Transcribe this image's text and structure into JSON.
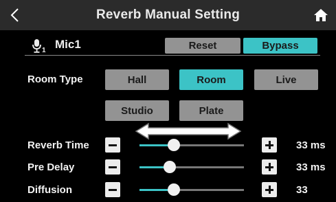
{
  "header": {
    "title": "Reverb Manual Setting",
    "back_icon": "chevron-left-icon",
    "home_icon": "home-icon"
  },
  "channel": {
    "icon": "mic-icon",
    "subscript": "1",
    "label": "Mic1",
    "reset_label": "Reset",
    "bypass_label": "Bypass",
    "bypass_active": true
  },
  "room_type": {
    "label": "Room Type",
    "options": [
      "Hall",
      "Room",
      "Live",
      "Studio",
      "Plate"
    ],
    "selected": "Room"
  },
  "params": [
    {
      "label": "Reverb Time",
      "value": "33",
      "unit": "ms",
      "level": 0.33
    },
    {
      "label": "Pre Delay",
      "value": "33",
      "unit": "ms",
      "level": 0.29
    },
    {
      "label": "Diffusion",
      "value": "33",
      "unit": "",
      "level": 0.33
    }
  ],
  "colors": {
    "accent": "#3cc3c6",
    "button_gray": "#939393",
    "header_bg": "#2b2b2b",
    "background": "#000000"
  }
}
